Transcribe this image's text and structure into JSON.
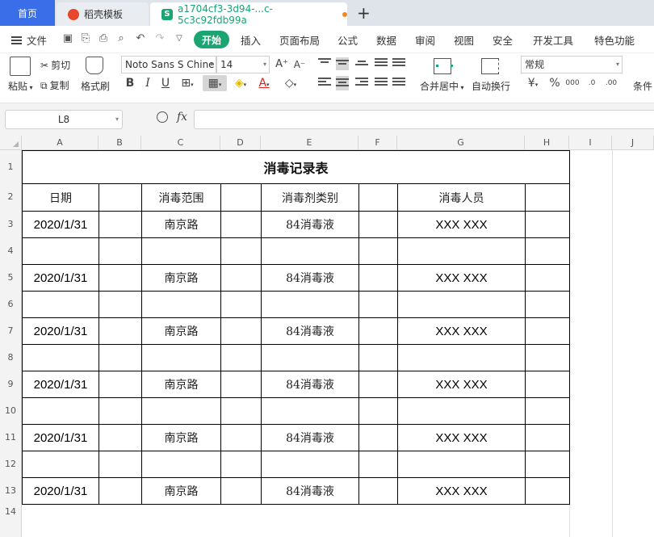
{
  "tabs": {
    "home": "首页",
    "template": "稻壳模板",
    "file": "a1704cf3-3d94-...c-5c3c92fdb99a",
    "new_tab": "+"
  },
  "menu": {
    "file": "文件",
    "items": [
      "开始",
      "插入",
      "页面布局",
      "公式",
      "数据",
      "审阅",
      "视图",
      "安全",
      "开发工具",
      "特色功能"
    ]
  },
  "ribbon": {
    "paste": "粘贴",
    "cut": "剪切",
    "copy": "复制",
    "format_painter": "格式刷",
    "font_name": "Noto Sans S Chine",
    "font_size": "14",
    "bold": "B",
    "italic": "I",
    "underline": "U",
    "merge_center": "合并居中",
    "wrap_text": "自动换行",
    "number_format": "常规",
    "conditional": "条件"
  },
  "formula_bar": {
    "cell_ref": "L8",
    "fx": "fx",
    "formula": ""
  },
  "columns": [
    "A",
    "B",
    "C",
    "D",
    "E",
    "F",
    "G",
    "H",
    "I",
    "J"
  ],
  "rows": [
    "1",
    "2",
    "3",
    "4",
    "5",
    "6",
    "7",
    "8",
    "9",
    "10",
    "11",
    "12",
    "13",
    "14"
  ],
  "sheet": {
    "title": "消毒记录表",
    "headers": {
      "date": "日期",
      "b": "",
      "range": "消毒范围",
      "d": "",
      "agent": "消毒剂类别",
      "f": "",
      "person": "消毒人员",
      "h": ""
    },
    "records": [
      {
        "date": "2020/1/31",
        "range": "南京路",
        "agent": "84消毒液",
        "person": "XXX XXX"
      },
      {
        "date": "",
        "range": "",
        "agent": "",
        "person": ""
      },
      {
        "date": "2020/1/31",
        "range": "南京路",
        "agent": "84消毒液",
        "person": "XXX XXX"
      },
      {
        "date": "",
        "range": "",
        "agent": "",
        "person": ""
      },
      {
        "date": "2020/1/31",
        "range": "南京路",
        "agent": "84消毒液",
        "person": "XXX XXX"
      },
      {
        "date": "",
        "range": "",
        "agent": "",
        "person": ""
      },
      {
        "date": "2020/1/31",
        "range": "南京路",
        "agent": "84消毒液",
        "person": "XXX XXX"
      },
      {
        "date": "",
        "range": "",
        "agent": "",
        "person": ""
      },
      {
        "date": "2020/1/31",
        "range": "南京路",
        "agent": "84消毒液",
        "person": "XXX XXX"
      },
      {
        "date": "",
        "range": "",
        "agent": "",
        "person": ""
      },
      {
        "date": "2020/1/31",
        "range": "南京路",
        "agent": "84消毒液",
        "person": "XXX XXX"
      }
    ]
  },
  "colors": {
    "accent_green": "#1ba572",
    "home_tab_blue": "#3a6ee8",
    "modified_dot": "#f08a24"
  }
}
